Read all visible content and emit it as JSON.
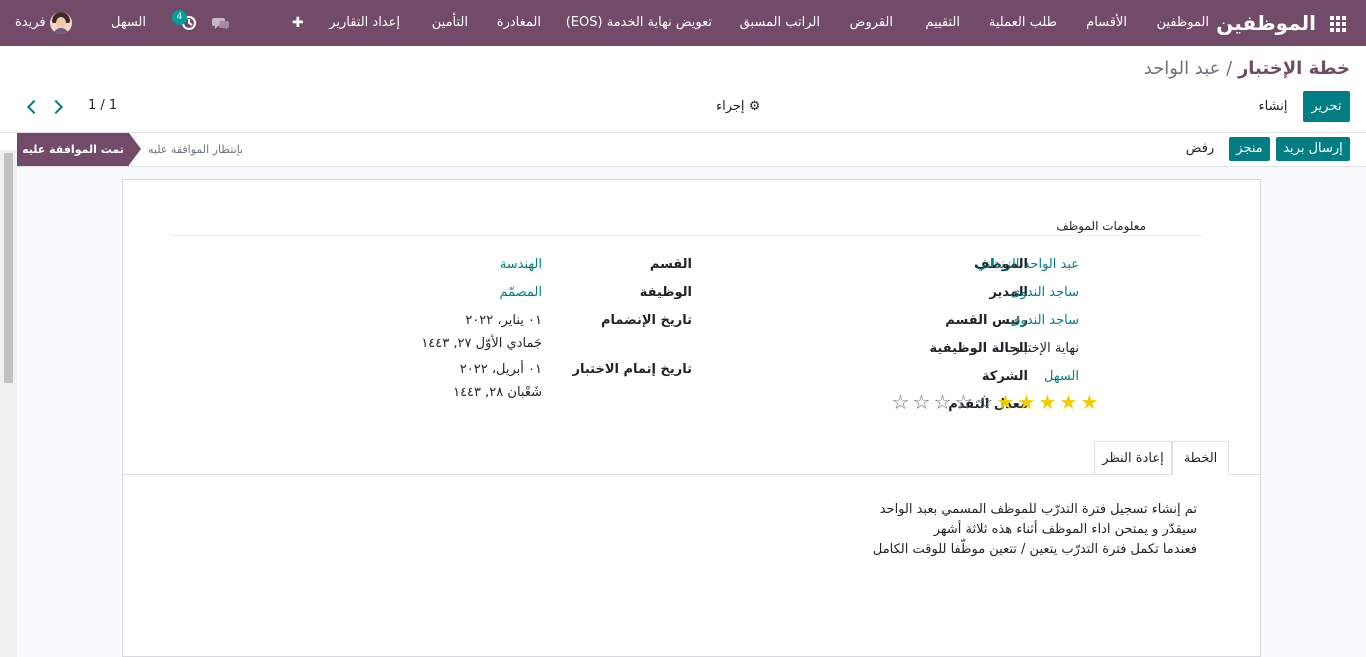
{
  "navbar": {
    "brand": "الموظفين",
    "menu": [
      "الموظفين",
      "الأقسام",
      "طلب العملية",
      "التقييم",
      "القروض",
      "الراتب المسبق",
      "تعويض نهاية الخدمة (EOS)",
      "المغادرة",
      "التأمين",
      "إعداد التقارير"
    ],
    "plus": "✚",
    "activity_count": "4",
    "company": "السهل",
    "user": "فريدة"
  },
  "breadcrumb": {
    "parent": "خطة الإختبار",
    "separator": " / ",
    "current": "عبد الواحد"
  },
  "controls": {
    "edit": "تحرير",
    "create": "إنشاء",
    "action": "إجراء",
    "pager": "1 / 1"
  },
  "status": {
    "send_mail": "إرسال بريد",
    "done": "منجز",
    "reject": "رفض",
    "stage_active": "تمت الموافقة عليه",
    "stage_next": "بإنتظار الموافقة عليه"
  },
  "form": {
    "section": "معلومات الموظف",
    "labels": {
      "employee": "الموظف",
      "manager": "المدير",
      "dept_head": "رئيس القسم",
      "job_status": "الحالة الوظيفية",
      "company": "الشركة",
      "progress": "معدل التقدم",
      "department": "القسم",
      "job": "الوظيفة",
      "join_date": "تاريخ الإنضمام",
      "probation_end": "تاريخ إتمام الاختبار"
    },
    "values": {
      "employee": "عبد الواحد الزنداني",
      "manager": "ساجد الندوى",
      "dept_head": "ساجد الندوى",
      "job_status": "نهاية الإختبار",
      "company": "السهل",
      "department": "الهندسة",
      "job": "المصمّم",
      "join_date": "٠١ يناير، ٢٠٢٢",
      "join_date_hijri": "جَمادي الأوّل ٢٧, ١٤٤٣",
      "probation_end": "٠١ أبريل، ٢٠٢٢",
      "probation_end_hijri": "شَعْبان ٢٨, ١٤٤٣"
    },
    "progress_rating": {
      "filled": 5,
      "total": 10
    }
  },
  "tabs": [
    "الخطة",
    "إعادة النظر"
  ],
  "plan_notes": [
    "تم إنشاء تسجيل فترة التدرّب للموظف المسمي بعبد الواحد",
    "سيقدّر و يمتحن اداء الموظف أثناء هذه ثلاثة أشهر",
    "فعندما تكمل فترة التدرّب يتعين / تتعين موظّفا للوقت الكامل"
  ]
}
